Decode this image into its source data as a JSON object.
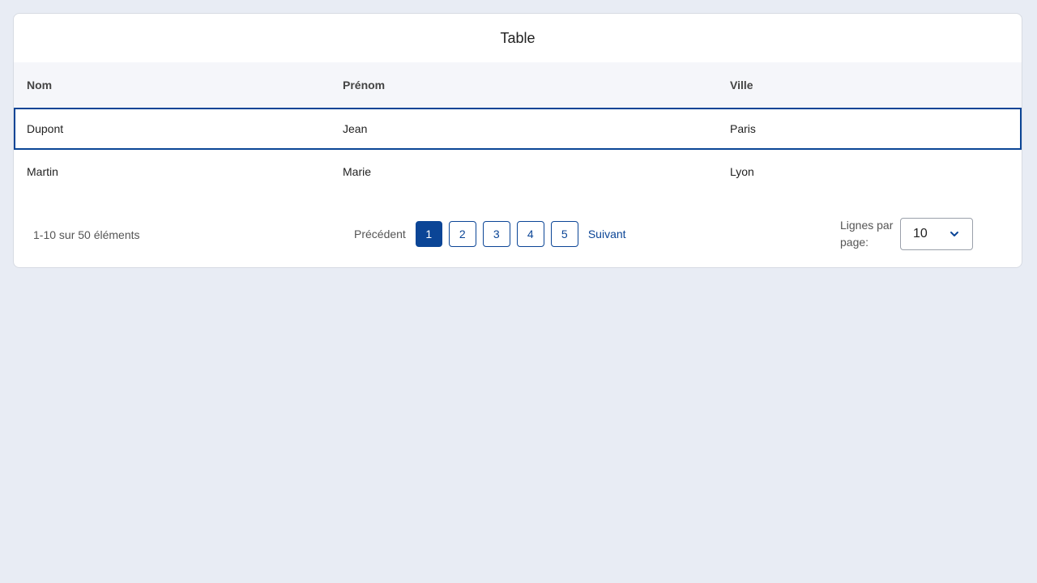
{
  "card": {
    "title": "Table"
  },
  "table": {
    "columns": [
      "Nom",
      "Prénom",
      "Ville"
    ],
    "rows": [
      {
        "nom": "Dupont",
        "prenom": "Jean",
        "ville": "Paris"
      },
      {
        "nom": "Martin",
        "prenom": "Marie",
        "ville": "Lyon"
      }
    ]
  },
  "footer": {
    "range_text": "1-10 sur 50 éléments",
    "prev_label": "Précédent",
    "next_label": "Suivant",
    "pages": [
      "1",
      "2",
      "3",
      "4",
      "5"
    ],
    "rows_per_page_label": "Lignes par page:",
    "rows_per_page_value": "10",
    "chevron_icon": "chevron-down-icon"
  },
  "colors": {
    "accent": "#0b4596",
    "background": "#e8ecf4",
    "header_bg": "#f5f6fa"
  }
}
